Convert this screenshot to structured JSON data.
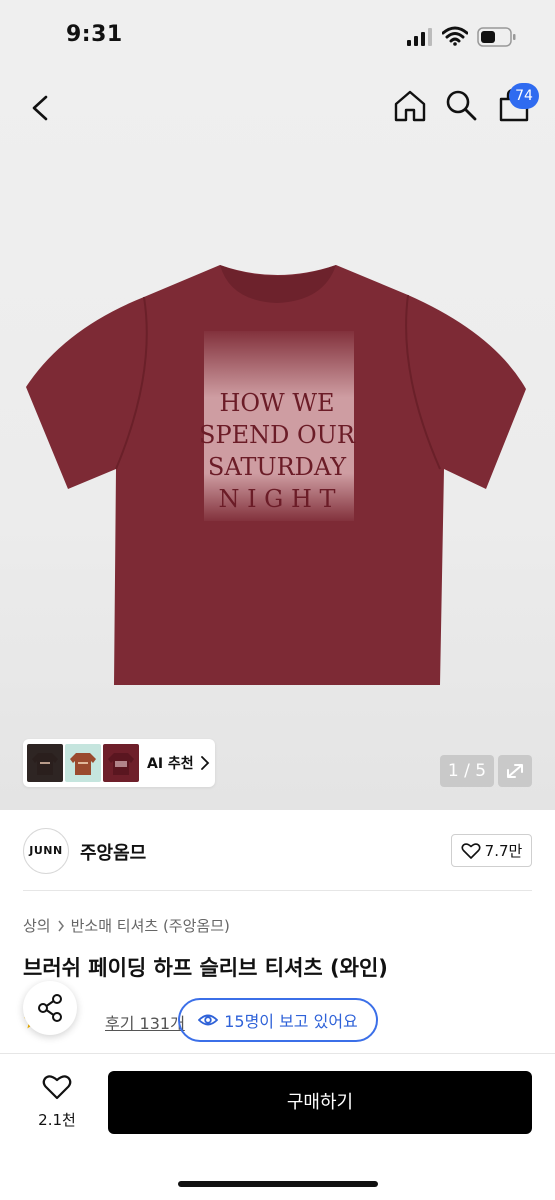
{
  "status_bar": {
    "time": "9:31"
  },
  "header": {
    "cart_count": "74"
  },
  "ai_recommend": {
    "label": "AI 추천"
  },
  "gallery": {
    "page_indicator": "1 / 5",
    "current": 1,
    "total": 5
  },
  "brand": {
    "logo_text": "JUNN",
    "name": "주앙옴므",
    "likes": "7.7만"
  },
  "breadcrumb": {
    "level1": "상의",
    "level2": "반소매 티셔츠 (주앙옴므)"
  },
  "product": {
    "title": "브러쉬 페이딩 하프 슬리브 티셔츠 (와인)",
    "print_lines": [
      "HOW WE",
      "SPEND OUR",
      "SATURDAY",
      "N I G H T"
    ]
  },
  "reviews": {
    "link": "후기 131개"
  },
  "viewers": {
    "text": "15명이 보고 있어요"
  },
  "bottom_bar": {
    "wish_count": "2.1천",
    "buy_label": "구매하기"
  },
  "colors": {
    "accent_blue": "#2f6bf0",
    "shirt_wine": "#7d2a35",
    "buy_button": "#000000"
  }
}
